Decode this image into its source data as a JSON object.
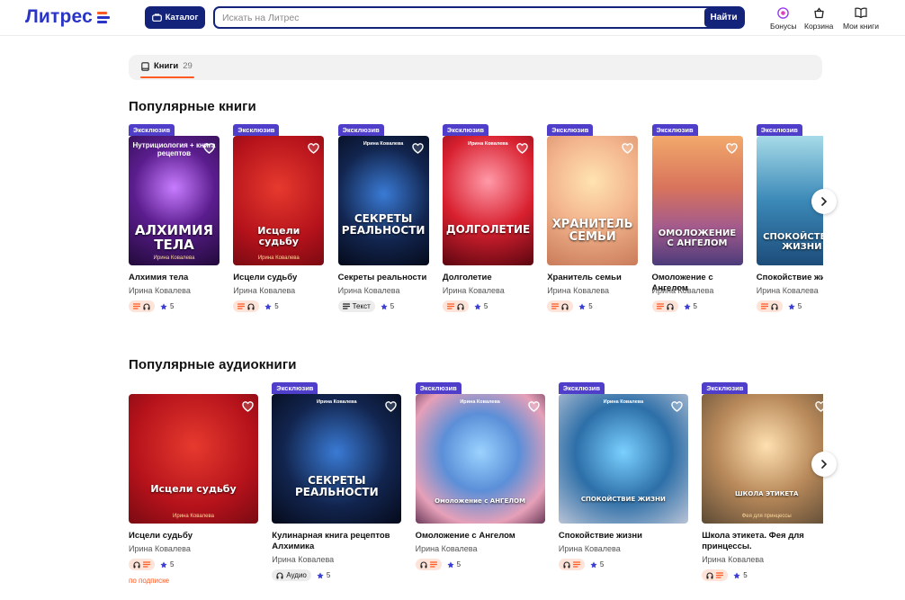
{
  "header": {
    "logo": "Литрес",
    "catalog_label": "Каталог",
    "search_placeholder": "Искать на Литрес",
    "search_button": "Найти",
    "actions": [
      {
        "label": "Бонусы",
        "icon": "bonus-icon"
      },
      {
        "label": "Корзина",
        "icon": "cart-icon"
      },
      {
        "label": "Мои книги",
        "icon": "book-icon"
      }
    ]
  },
  "tabs": [
    {
      "label": "Книги",
      "count": "29",
      "icon": "book-icon"
    }
  ],
  "popular_books": {
    "title": "Популярные книги",
    "items": [
      {
        "title": "Алхимия тела",
        "author": "Ирина Ковалева",
        "exclusive": "Эксклюзив",
        "cover_title": "АЛХИМИЯ ТЕЛА",
        "cover_top": "Нутрициология + книга рецептов",
        "cover_author": "Ирина Ковалева",
        "formats": [
          "text",
          "audio"
        ],
        "rating": "5"
      },
      {
        "title": "Исцели судьбу",
        "author": "Ирина Ковалева",
        "exclusive": "Эксклюзив",
        "cover_title": "Исцели судьбу",
        "cover_top": "",
        "cover_author": "Ирина Ковалева",
        "formats": [
          "text",
          "audio"
        ],
        "rating": "5"
      },
      {
        "title": "Секреты реальности",
        "author": "Ирина Ковалева",
        "exclusive": "Эксклюзив",
        "cover_title": "СЕКРЕТЫ РЕАЛЬНОСТИ",
        "cover_top": "Ирина Ковалева",
        "cover_author": "",
        "formats": [
          "text-only"
        ],
        "format_label": "Текст",
        "rating": "5"
      },
      {
        "title": "Долголетие",
        "author": "Ирина Ковалева",
        "exclusive": "Эксклюзив",
        "cover_title": "ДОЛГОЛЕТИЕ",
        "cover_top": "Ирина Ковалева",
        "cover_author": "",
        "formats": [
          "text",
          "audio"
        ],
        "rating": "5"
      },
      {
        "title": "Хранитель семьи",
        "author": "Ирина Ковалева",
        "exclusive": "Эксклюзив",
        "cover_title": "ХРАНИТЕЛЬ СЕМЬИ",
        "cover_top": "",
        "cover_author": "",
        "formats": [
          "text",
          "audio"
        ],
        "rating": "5"
      },
      {
        "title": "Омоложение с Ангелом",
        "author": "Ирина Ковалева",
        "exclusive": "Эксклюзив",
        "cover_title": "ОМОЛОЖЕНИЕ С АНГЕЛОМ",
        "cover_top": "",
        "cover_author": "",
        "formats": [
          "text",
          "audio"
        ],
        "rating": "5"
      },
      {
        "title": "Спокойствие жизни",
        "author": "Ирина Ковалева",
        "exclusive": "Эксклюзив",
        "cover_title": "СПОКОЙСТВИЕ ЖИЗНИ",
        "cover_top": "",
        "cover_author": "",
        "formats": [
          "text",
          "audio"
        ],
        "rating": "5"
      }
    ]
  },
  "popular_audiobooks": {
    "title": "Популярные аудиокниги",
    "items": [
      {
        "title": "Исцели судьбу",
        "author": "Ирина Ковалева",
        "exclusive": "",
        "cover_title": "Исцели судьбу",
        "cover_top": "",
        "cover_author": "Ирина Ковалева",
        "formats": [
          "audio",
          "text"
        ],
        "rating": "5",
        "note": "по подписке"
      },
      {
        "title": "Кулинарная книга рецептов Алхимика",
        "author": "Ирина Ковалева",
        "exclusive": "Эксклюзив",
        "cover_title": "СЕКРЕТЫ РЕАЛЬНОСТИ",
        "cover_top": "Ирина Ковалева",
        "cover_author": "",
        "formats": [
          "audio-only"
        ],
        "format_label": "Аудио",
        "rating": "5",
        "note": ""
      },
      {
        "title": "Омоложение с Ангелом",
        "author": "Ирина Ковалева",
        "exclusive": "Эксклюзив",
        "cover_title": "Омоложение с АНГЕЛОМ",
        "cover_top": "Ирина Ковалева",
        "cover_author": "",
        "formats": [
          "audio",
          "text"
        ],
        "rating": "5",
        "note": ""
      },
      {
        "title": "Спокойствие жизни",
        "author": "Ирина Ковалева",
        "exclusive": "Эксклюзив",
        "cover_title": "СПОКОЙСТВИЕ ЖИЗНИ",
        "cover_top": "Ирина Ковалева",
        "cover_author": "",
        "formats": [
          "audio",
          "text"
        ],
        "rating": "5",
        "note": ""
      },
      {
        "title": "Школа этикета. Фея для принцессы.",
        "author": "Ирина Ковалева",
        "exclusive": "Эксклюзив",
        "cover_title": "ШКОЛА ЭТИКЕТА",
        "cover_top": "",
        "cover_author": "Фея для принцессы",
        "formats": [
          "audio",
          "text"
        ],
        "rating": "5",
        "note": ""
      }
    ]
  },
  "colors": {
    "brand": "#2a35c7",
    "navy": "#13237a",
    "accent": "#ff5a23",
    "exclusive": "#4f3ec9"
  }
}
